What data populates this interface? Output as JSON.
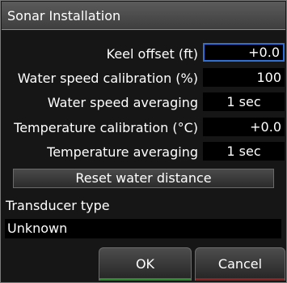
{
  "dialog": {
    "title": "Sonar Installation"
  },
  "settings": [
    {
      "label": "Keel offset (ft)",
      "value": "+0.0"
    },
    {
      "label": "Water speed calibration (%)",
      "value": "100"
    },
    {
      "label": "Water speed averaging",
      "value": "1 sec"
    },
    {
      "label": "Temperature calibration (°C)",
      "value": "+0.0"
    },
    {
      "label": "Temperature averaging",
      "value": "1 sec"
    }
  ],
  "reset_button": {
    "label": "Reset water distance"
  },
  "transducer": {
    "label": "Transducer type",
    "value": "Unknown"
  },
  "buttons": {
    "ok": "OK",
    "cancel": "Cancel"
  },
  "colors": {
    "focus_border": "#2f6fd8",
    "ok_accent": "#2c8a2c",
    "cancel_accent": "#8a2222"
  }
}
